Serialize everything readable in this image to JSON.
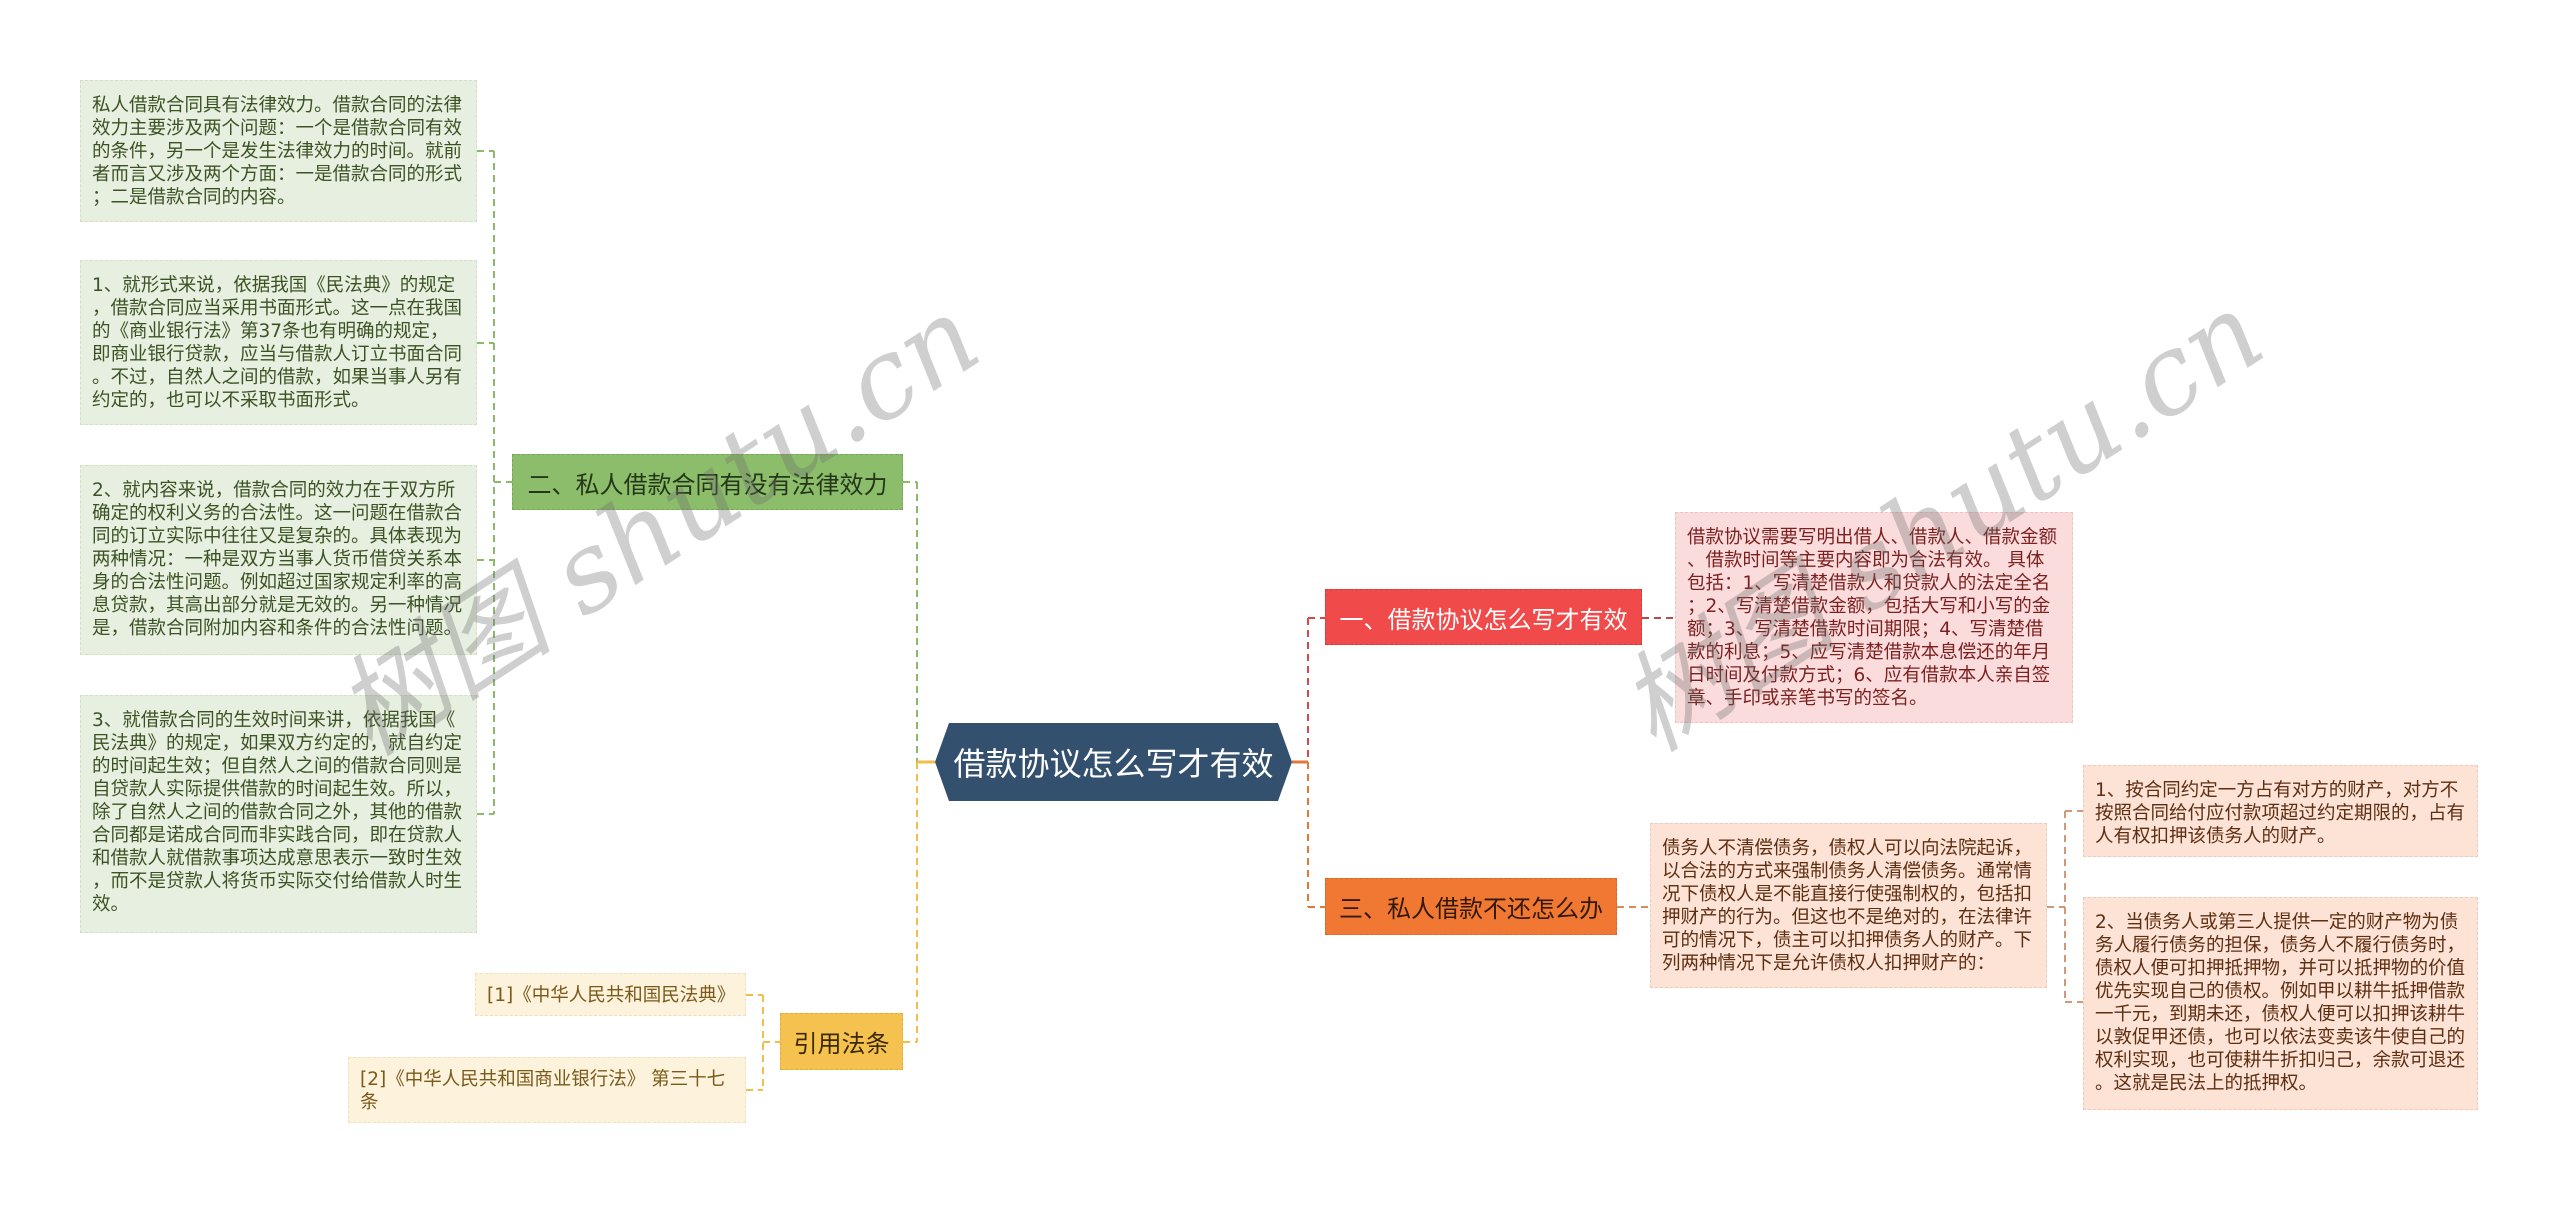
{
  "title": "借款协议怎么写才有效",
  "root": {
    "label": "借款协议怎么写才有效",
    "color": "#34506f"
  },
  "branches": {
    "legal_effect": {
      "label": "二、私人借款合同有没有法律效力",
      "color": "#8bbd6b",
      "details": [
        {
          "lines": [
            "私人借款合同具有法律效力。借款合同的法律",
            "效力主要涉及两个问题：一个是借款合同有效",
            "的条件，另一个是发生法律效力的时间。就前",
            "者而言又涉及两个方面：一是借款合同的形式",
            "；二是借款合同的内容。"
          ]
        },
        {
          "lines": [
            "1、就形式来说，依据我国《民法典》的规定",
            "，借款合同应当采用书面形式。这一点在我国",
            "的《商业银行法》第37条也有明确的规定，",
            "即商业银行贷款，应当与借款人订立书面合同",
            "。不过，自然人之间的借款，如果当事人另有",
            "约定的，也可以不采取书面形式。"
          ]
        },
        {
          "lines": [
            "2、就内容来说，借款合同的效力在于双方所",
            "确定的权利义务的合法性。这一问题在借款合",
            "同的订立实际中往往又是复杂的。具体表现为",
            "两种情况：一种是双方当事人货币借贷关系本",
            "身的合法性问题。例如超过国家规定利率的高",
            "息贷款，其高出部分就是无效的。另一种情况",
            "是，借款合同附加内容和条件的合法性问题。"
          ]
        },
        {
          "lines": [
            "3、就借款合同的生效时间来讲，依据我国《",
            "民法典》的规定，如果双方约定的，就自约定",
            "的时间起生效；但自然人之间的借款合同则是",
            "自贷款人实际提供借款的时间起生效。所以，",
            "除了自然人之间的借款合同之外，其他的借款",
            "合同都是诺成合同而非实践合同，即在贷款人",
            "和借款人就借款事项达成意思表示一致时生效",
            "，而不是贷款人将货币实际交付给借款人时生",
            "效。"
          ]
        }
      ]
    },
    "how_to_write": {
      "label": "一、借款协议怎么写才有效",
      "color": "#f04a4a",
      "detail": {
        "lines": [
          "借款协议需要写明出借人、借款人、借款金额",
          "、借款时间等主要内容即为合法有效。 具体",
          "包括：1、写清楚借款人和贷款人的法定全名",
          "；2、写清楚借款金额，包括大写和小写的金",
          "额；3、写清楚借款时间期限；4、写清楚借",
          "款的利息；5、应写清楚借款本息偿还的年月",
          "日时间及付款方式；6、应有借款本人亲自签",
          "章、手印或亲笔书写的签名。"
        ]
      }
    },
    "not_repaid": {
      "label": "三、私人借款不还怎么办",
      "color": "#f07832",
      "detail": {
        "lines": [
          "债务人不清偿债务，债权人可以向法院起诉，",
          "以合法的方式来强制债务人清偿债务。通常情",
          "况下债权人是不能直接行使强制权的，包括扣",
          "押财产的行为。但这也不是绝对的，在法律许",
          "可的情况下，债主可以扣押债务人的财产。下",
          "列两种情况下是允许债权人扣押财产的："
        ]
      },
      "sub_details": [
        {
          "lines": [
            "1、按合同约定一方占有对方的财产，对方不",
            "按照合同给付应付款项超过约定期限的，占有",
            "人有权扣押该债务人的财产。"
          ]
        },
        {
          "lines": [
            "2、当债务人或第三人提供一定的财产物为债",
            "务人履行债务的担保，债务人不履行债务时，",
            "债权人便可扣押抵押物，并可以抵押物的价值",
            "优先实现自己的债权。例如甲以耕牛抵押借款",
            "一千元，到期未还，债权人便可以扣押该耕牛",
            "以敦促甲还债，也可以依法变卖该牛使自己的",
            "权利实现，也可使耕牛折扣归己，余款可退还",
            "。这就是民法上的抵押权。"
          ]
        }
      ]
    },
    "references": {
      "label": "引用法条",
      "color": "#f6c24f",
      "items": [
        {
          "lines": [
            "[1]《中华人民共和国民法典》"
          ]
        },
        {
          "lines": [
            "[2]《中华人民共和国商业银行法》 第三十七",
            "条"
          ]
        }
      ]
    }
  },
  "watermark": "树图 shutu.cn"
}
